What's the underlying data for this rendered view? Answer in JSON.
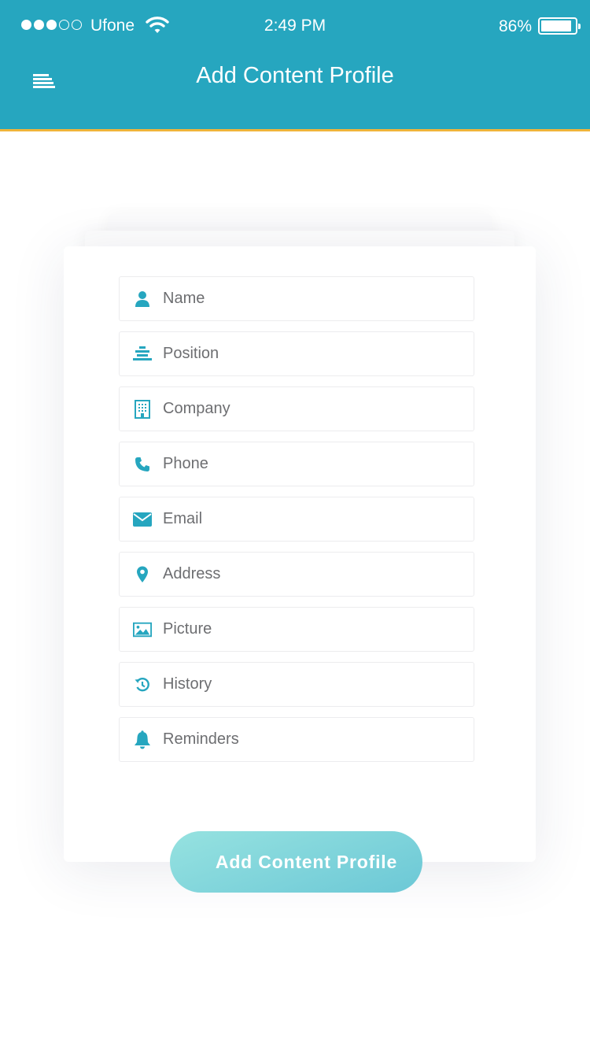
{
  "status_bar": {
    "carrier": "Ufone",
    "time": "2:49 PM",
    "battery_percent": "86%",
    "battery_level": 0.86,
    "signal_filled": 3,
    "signal_total": 5
  },
  "header": {
    "title": "Add Content Profile",
    "menu_icon": "menu-icon",
    "background": "#26a6bf",
    "accent_line": "#f0b43a"
  },
  "form": {
    "fields": [
      {
        "label": "Name",
        "icon": "user-icon"
      },
      {
        "label": "Position",
        "icon": "position-icon"
      },
      {
        "label": "Company",
        "icon": "building-icon"
      },
      {
        "label": "Phone",
        "icon": "phone-icon"
      },
      {
        "label": "Email",
        "icon": "envelope-icon"
      },
      {
        "label": "Address",
        "icon": "map-pin-icon"
      },
      {
        "label": "Picture",
        "icon": "image-icon"
      },
      {
        "label": "History",
        "icon": "history-icon"
      },
      {
        "label": "Reminders",
        "icon": "bell-icon"
      }
    ],
    "icon_color": "#26a6bf"
  },
  "submit": {
    "label": "Add Content Profile"
  }
}
